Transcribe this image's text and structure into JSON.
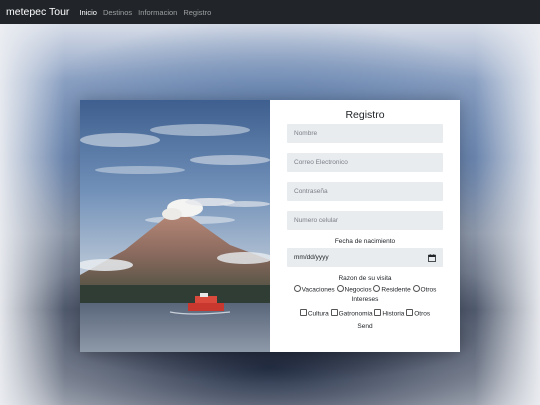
{
  "navbar": {
    "brand": "metepec Tour",
    "links": [
      "Inicio",
      "Destinos",
      "Informacion",
      "Registro"
    ]
  },
  "form": {
    "title": "Registro",
    "nombre_placeholder": "Nombre",
    "correo_placeholder": "Correo Electronico",
    "password_placeholder": "Contraseña",
    "celular_placeholder": "Numero celular",
    "birth_label": "Fecha de nacimiento",
    "date_value": "mm/dd/yyyy",
    "visit_label": "Razon de su visita",
    "visit_options": [
      "Vacaciones",
      "Negocios",
      "Residente",
      "Otros"
    ],
    "interests_label": "Intereses",
    "interest_options": [
      "Cultura",
      "Gatronomia",
      "Historia",
      "Otros"
    ],
    "send_label": "Send"
  },
  "colors": {
    "navbar_bg": "#212529",
    "field_bg": "#e9ecef",
    "panel_bg": "#ffffff"
  }
}
